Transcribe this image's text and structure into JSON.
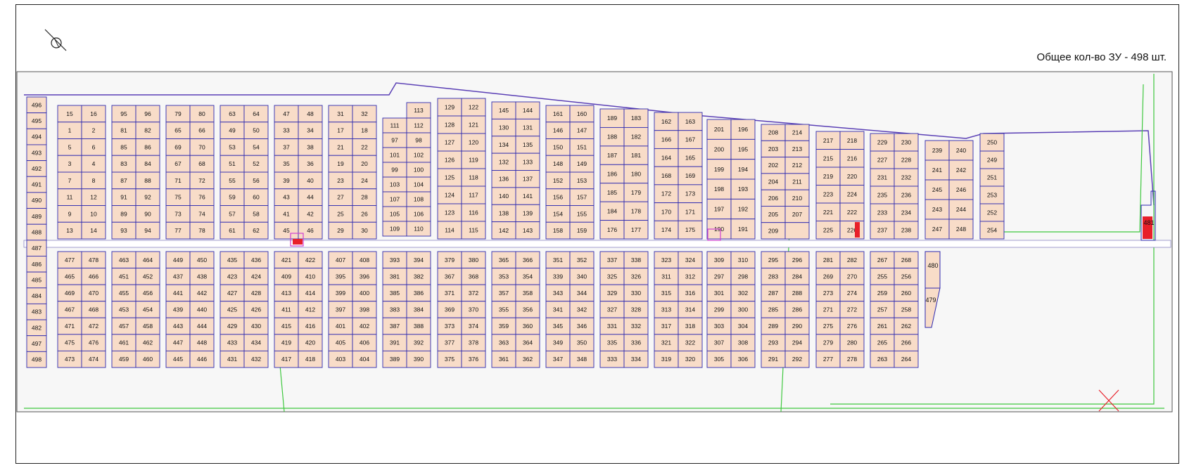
{
  "header": {
    "count_label": "Общее кол-во ЗУ - 498 шт."
  },
  "colors": {
    "plot_fill": "#f8dcc8",
    "plot_stroke": "#2e2ab0",
    "highlight": "#e8202a",
    "boundary": "#5a3fb5",
    "utility": "#3ec83e"
  },
  "icons": {
    "north_arrow": "north-arrow-icon",
    "marker": "x-mark-icon"
  },
  "top_blocks": [
    {
      "rows": [
        [
          "15",
          "16"
        ],
        [
          "1",
          "2"
        ],
        [
          "5",
          "6"
        ],
        [
          "3",
          "4"
        ],
        [
          "7",
          "8"
        ],
        [
          "11",
          "12"
        ],
        [
          "9",
          "10"
        ],
        [
          "13",
          "14"
        ]
      ]
    },
    {
      "rows": [
        [
          "95",
          "96"
        ],
        [
          "81",
          "82"
        ],
        [
          "85",
          "86"
        ],
        [
          "83",
          "84"
        ],
        [
          "87",
          "88"
        ],
        [
          "91",
          "92"
        ],
        [
          "89",
          "90"
        ],
        [
          "93",
          "94"
        ]
      ]
    },
    {
      "rows": [
        [
          "79",
          "80"
        ],
        [
          "65",
          "66"
        ],
        [
          "69",
          "70"
        ],
        [
          "67",
          "68"
        ],
        [
          "71",
          "72"
        ],
        [
          "75",
          "76"
        ],
        [
          "73",
          "74"
        ],
        [
          "77",
          "78"
        ]
      ]
    },
    {
      "rows": [
        [
          "63",
          "64"
        ],
        [
          "49",
          "50"
        ],
        [
          "53",
          "54"
        ],
        [
          "51",
          "52"
        ],
        [
          "55",
          "56"
        ],
        [
          "59",
          "60"
        ],
        [
          "57",
          "58"
        ],
        [
          "61",
          "62"
        ]
      ]
    },
    {
      "rows": [
        [
          "47",
          "48"
        ],
        [
          "33",
          "34"
        ],
        [
          "37",
          "38"
        ],
        [
          "35",
          "36"
        ],
        [
          "39",
          "40"
        ],
        [
          "43",
          "44"
        ],
        [
          "41",
          "42"
        ],
        [
          "45",
          "46"
        ]
      ]
    },
    {
      "rows": [
        [
          "31",
          "32"
        ],
        [
          "17",
          "18"
        ],
        [
          "21",
          "22"
        ],
        [
          "19",
          "20"
        ],
        [
          "23",
          "24"
        ],
        [
          "27",
          "28"
        ],
        [
          "25",
          "26"
        ],
        [
          "29",
          "30"
        ]
      ]
    },
    {
      "single_top": "113",
      "rows": [
        [
          "111",
          "112"
        ],
        [
          "97",
          "98"
        ],
        [
          "101",
          "102"
        ],
        [
          "99",
          "100"
        ],
        [
          "103",
          "104"
        ],
        [
          "107",
          "108"
        ],
        [
          "105",
          "106"
        ],
        [
          "109",
          "110"
        ]
      ]
    },
    {
      "rows": [
        [
          "129",
          "122"
        ],
        [
          "128",
          "121"
        ],
        [
          "127",
          "120"
        ],
        [
          "126",
          "119"
        ],
        [
          "125",
          "118"
        ],
        [
          "124",
          "117"
        ],
        [
          "123",
          "116"
        ],
        [
          "114",
          "115"
        ]
      ]
    },
    {
      "rows": [
        [
          "145",
          "144"
        ],
        [
          "130",
          "131"
        ],
        [
          "134",
          "135"
        ],
        [
          "132",
          "133"
        ],
        [
          "136",
          "137"
        ],
        [
          "140",
          "141"
        ],
        [
          "138",
          "139"
        ],
        [
          "142",
          "143"
        ]
      ]
    },
    {
      "rows": [
        [
          "161",
          "160"
        ],
        [
          "146",
          "147"
        ],
        [
          "150",
          "151"
        ],
        [
          "148",
          "149"
        ],
        [
          "152",
          "153"
        ],
        [
          "156",
          "157"
        ],
        [
          "154",
          "155"
        ],
        [
          "158",
          "159"
        ]
      ]
    },
    {
      "rows": [
        [
          "189",
          "183"
        ],
        [
          "188",
          "182"
        ],
        [
          "187",
          "181"
        ],
        [
          "186",
          "180"
        ],
        [
          "185",
          "179"
        ],
        [
          "184",
          "178"
        ],
        [
          "176",
          "177"
        ]
      ]
    },
    {
      "rows": [
        [
          "162",
          "163"
        ],
        [
          "166",
          "167"
        ],
        [
          "164",
          "165"
        ],
        [
          "168",
          "169"
        ],
        [
          "172",
          "173"
        ],
        [
          "170",
          "171"
        ],
        [
          "174",
          "175"
        ]
      ]
    },
    {
      "rows": [
        [
          "201",
          "196"
        ],
        [
          "200",
          "195"
        ],
        [
          "199",
          "194"
        ],
        [
          "198",
          "193"
        ],
        [
          "197",
          "192"
        ],
        [
          "190",
          "191"
        ]
      ]
    },
    {
      "rows": [
        [
          "208",
          "214"
        ],
        [
          "203",
          "213"
        ],
        [
          "202",
          "212"
        ],
        [
          "204",
          "211"
        ],
        [
          "206",
          "210"
        ],
        [
          "205",
          "207"
        ],
        [
          "209",
          ""
        ]
      ]
    },
    {
      "rows": [
        [
          "217",
          "218"
        ],
        [
          "215",
          "216"
        ],
        [
          "219",
          "220"
        ],
        [
          "223",
          "224"
        ],
        [
          "221",
          "222"
        ],
        [
          "225",
          "226"
        ]
      ]
    },
    {
      "rows": [
        [
          "229",
          "230"
        ],
        [
          "227",
          "228"
        ],
        [
          "231",
          "232"
        ],
        [
          "235",
          "236"
        ],
        [
          "233",
          "234"
        ],
        [
          "237",
          "238"
        ]
      ]
    },
    {
      "rows": [
        [
          "239",
          "240"
        ],
        [
          "241",
          "242"
        ],
        [
          "245",
          "246"
        ],
        [
          "243",
          "244"
        ],
        [
          "247",
          "248"
        ]
      ]
    },
    {
      "rows": [
        [
          "250"
        ],
        [
          "249"
        ],
        [
          "251"
        ],
        [
          "253"
        ],
        [
          "252"
        ],
        [
          "254"
        ]
      ]
    }
  ],
  "bottom_blocks": [
    {
      "rows": [
        [
          "477",
          "478"
        ],
        [
          "465",
          "466"
        ],
        [
          "469",
          "470"
        ],
        [
          "467",
          "468"
        ],
        [
          "471",
          "472"
        ],
        [
          "475",
          "476"
        ],
        [
          "473",
          "474"
        ]
      ]
    },
    {
      "rows": [
        [
          "463",
          "464"
        ],
        [
          "451",
          "452"
        ],
        [
          "455",
          "456"
        ],
        [
          "453",
          "454"
        ],
        [
          "457",
          "458"
        ],
        [
          "461",
          "462"
        ],
        [
          "459",
          "460"
        ]
      ]
    },
    {
      "rows": [
        [
          "449",
          "450"
        ],
        [
          "437",
          "438"
        ],
        [
          "441",
          "442"
        ],
        [
          "439",
          "440"
        ],
        [
          "443",
          "444"
        ],
        [
          "447",
          "448"
        ],
        [
          "445",
          "446"
        ]
      ]
    },
    {
      "rows": [
        [
          "435",
          "436"
        ],
        [
          "423",
          "424"
        ],
        [
          "427",
          "428"
        ],
        [
          "425",
          "426"
        ],
        [
          "429",
          "430"
        ],
        [
          "433",
          "434"
        ],
        [
          "431",
          "432"
        ]
      ]
    },
    {
      "rows": [
        [
          "421",
          "422"
        ],
        [
          "409",
          "410"
        ],
        [
          "413",
          "414"
        ],
        [
          "411",
          "412"
        ],
        [
          "415",
          "416"
        ],
        [
          "419",
          "420"
        ],
        [
          "417",
          "418"
        ]
      ]
    },
    {
      "rows": [
        [
          "407",
          "408"
        ],
        [
          "395",
          "396"
        ],
        [
          "399",
          "400"
        ],
        [
          "397",
          "398"
        ],
        [
          "401",
          "402"
        ],
        [
          "405",
          "406"
        ],
        [
          "403",
          "404"
        ]
      ]
    },
    {
      "rows": [
        [
          "393",
          "394"
        ],
        [
          "381",
          "382"
        ],
        [
          "385",
          "386"
        ],
        [
          "383",
          "384"
        ],
        [
          "387",
          "388"
        ],
        [
          "391",
          "392"
        ],
        [
          "389",
          "390"
        ]
      ]
    },
    {
      "rows": [
        [
          "379",
          "380"
        ],
        [
          "367",
          "368"
        ],
        [
          "371",
          "372"
        ],
        [
          "369",
          "370"
        ],
        [
          "373",
          "374"
        ],
        [
          "377",
          "378"
        ],
        [
          "375",
          "376"
        ]
      ]
    },
    {
      "rows": [
        [
          "365",
          "366"
        ],
        [
          "353",
          "354"
        ],
        [
          "357",
          "358"
        ],
        [
          "355",
          "356"
        ],
        [
          "359",
          "360"
        ],
        [
          "363",
          "364"
        ],
        [
          "361",
          "362"
        ]
      ]
    },
    {
      "rows": [
        [
          "351",
          "352"
        ],
        [
          "339",
          "340"
        ],
        [
          "343",
          "344"
        ],
        [
          "341",
          "342"
        ],
        [
          "345",
          "346"
        ],
        [
          "349",
          "350"
        ],
        [
          "347",
          "348"
        ]
      ]
    },
    {
      "rows": [
        [
          "337",
          "338"
        ],
        [
          "325",
          "326"
        ],
        [
          "329",
          "330"
        ],
        [
          "327",
          "328"
        ],
        [
          "331",
          "332"
        ],
        [
          "335",
          "336"
        ],
        [
          "333",
          "334"
        ]
      ]
    },
    {
      "rows": [
        [
          "323",
          "324"
        ],
        [
          "311",
          "312"
        ],
        [
          "315",
          "316"
        ],
        [
          "313",
          "314"
        ],
        [
          "317",
          "318"
        ],
        [
          "321",
          "322"
        ],
        [
          "319",
          "320"
        ]
      ]
    },
    {
      "rows": [
        [
          "309",
          "310"
        ],
        [
          "297",
          "298"
        ],
        [
          "301",
          "302"
        ],
        [
          "299",
          "300"
        ],
        [
          "303",
          "304"
        ],
        [
          "307",
          "308"
        ],
        [
          "305",
          "306"
        ]
      ]
    },
    {
      "rows": [
        [
          "295",
          "296"
        ],
        [
          "283",
          "284"
        ],
        [
          "287",
          "288"
        ],
        [
          "285",
          "286"
        ],
        [
          "289",
          "290"
        ],
        [
          "293",
          "294"
        ],
        [
          "291",
          "292"
        ]
      ]
    },
    {
      "rows": [
        [
          "281",
          "282"
        ],
        [
          "269",
          "270"
        ],
        [
          "273",
          "274"
        ],
        [
          "271",
          "272"
        ],
        [
          "275",
          "276"
        ],
        [
          "279",
          "280"
        ],
        [
          "277",
          "278"
        ]
      ]
    },
    {
      "rows": [
        [
          "267",
          "268"
        ],
        [
          "255",
          "256"
        ],
        [
          "259",
          "260"
        ],
        [
          "257",
          "258"
        ],
        [
          "261",
          "262"
        ],
        [
          "265",
          "266"
        ],
        [
          "263",
          "264"
        ]
      ]
    }
  ],
  "left_column": [
    "496",
    "495",
    "494",
    "493",
    "492",
    "491",
    "490",
    "489",
    "488",
    "487",
    "486",
    "485",
    "484",
    "483",
    "482",
    "497",
    "498"
  ],
  "extra_labels": {
    "p480": "480",
    "p479": "479",
    "p481": "481"
  }
}
